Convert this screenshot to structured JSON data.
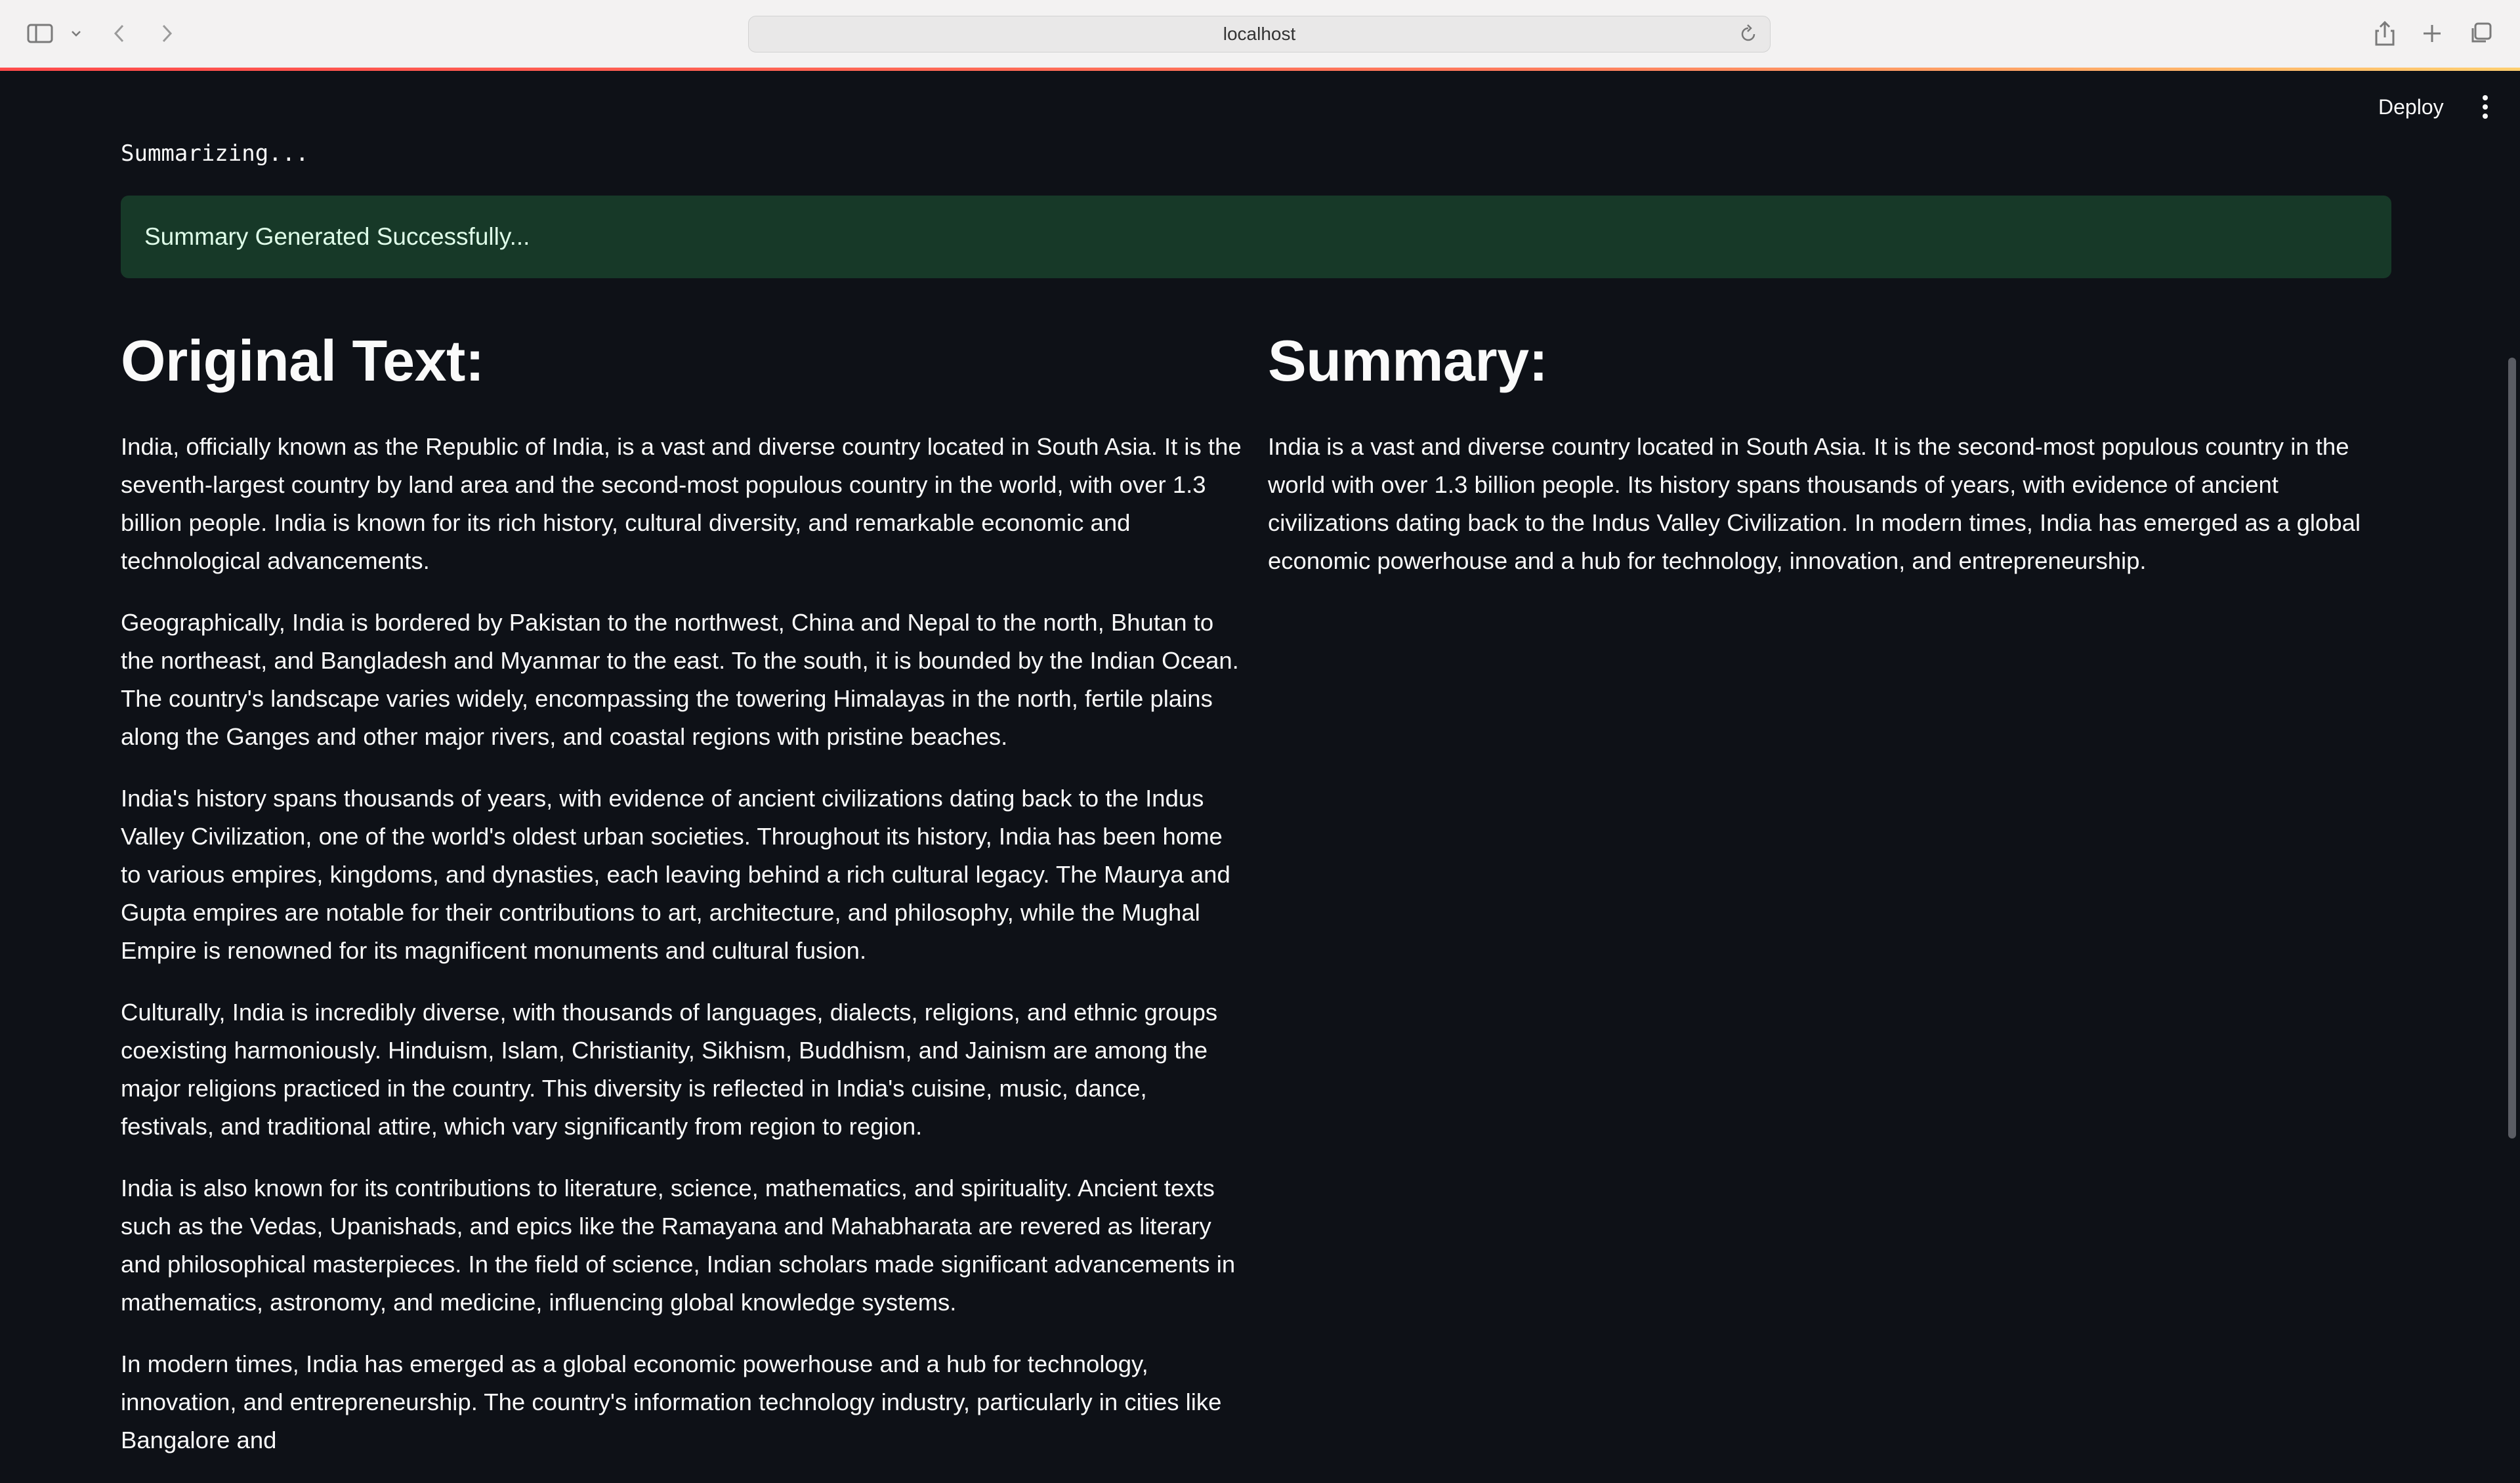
{
  "browser": {
    "url": "localhost"
  },
  "header": {
    "deploy_label": "Deploy"
  },
  "main": {
    "status_text": "Summarizing...",
    "success_message": "Summary Generated Successfully...",
    "original": {
      "heading": "Original Text:",
      "paragraphs": [
        "India, officially known as the Republic of India, is a vast and diverse country located in South Asia. It is the seventh-largest country by land area and the second-most populous country in the world, with over 1.3 billion people. India is known for its rich history, cultural diversity, and remarkable economic and technological advancements.",
        "Geographically, India is bordered by Pakistan to the northwest, China and Nepal to the north, Bhutan to the northeast, and Bangladesh and Myanmar to the east. To the south, it is bounded by the Indian Ocean. The country's landscape varies widely, encompassing the towering Himalayas in the north, fertile plains along the Ganges and other major rivers, and coastal regions with pristine beaches.",
        "India's history spans thousands of years, with evidence of ancient civilizations dating back to the Indus Valley Civilization, one of the world's oldest urban societies. Throughout its history, India has been home to various empires, kingdoms, and dynasties, each leaving behind a rich cultural legacy. The Maurya and Gupta empires are notable for their contributions to art, architecture, and philosophy, while the Mughal Empire is renowned for its magnificent monuments and cultural fusion.",
        "Culturally, India is incredibly diverse, with thousands of languages, dialects, religions, and ethnic groups coexisting harmoniously. Hinduism, Islam, Christianity, Sikhism, Buddhism, and Jainism are among the major religions practiced in the country. This diversity is reflected in India's cuisine, music, dance, festivals, and traditional attire, which vary significantly from region to region.",
        "India is also known for its contributions to literature, science, mathematics, and spirituality. Ancient texts such as the Vedas, Upanishads, and epics like the Ramayana and Mahabharata are revered as literary and philosophical masterpieces. In the field of science, Indian scholars made significant advancements in mathematics, astronomy, and medicine, influencing global knowledge systems.",
        "In modern times, India has emerged as a global economic powerhouse and a hub for technology, innovation, and entrepreneurship. The country's information technology industry, particularly in cities like Bangalore and"
      ]
    },
    "summary": {
      "heading": "Summary:",
      "text": "India is a vast and diverse country located in South Asia. It is the second-most populous country in the world with over 1.3 billion people. Its history spans thousands of years, with evidence of ancient civilizations dating back to the Indus Valley Civilization. In modern times, India has emerged as a global economic powerhouse and a hub for technology, innovation, and entrepreneurship."
    }
  }
}
